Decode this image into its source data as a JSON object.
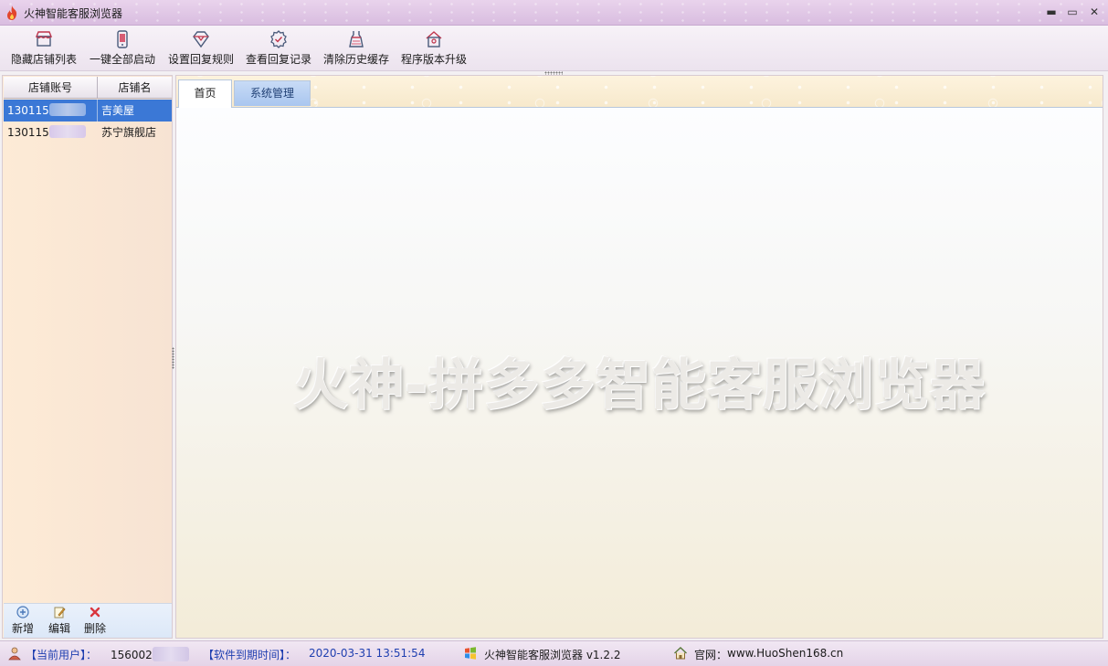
{
  "window": {
    "title": "火神智能客服浏览器",
    "minimize": "▬",
    "maximize": "▭",
    "close": "✕"
  },
  "toolbar": {
    "items": [
      {
        "label": "隐藏店铺列表",
        "icon": "store-icon"
      },
      {
        "label": "一键全部启动",
        "icon": "phone-icon"
      },
      {
        "label": "设置回复规则",
        "icon": "diamond-icon"
      },
      {
        "label": "查看回复记录",
        "icon": "badge-icon"
      },
      {
        "label": "清除历史缓存",
        "icon": "dress-icon"
      },
      {
        "label": "程序版本升级",
        "icon": "home-upgrade-icon"
      }
    ]
  },
  "shop_list": {
    "columns": [
      "店铺账号",
      "店铺名"
    ],
    "rows": [
      {
        "account": "130115",
        "name": "吉美屋",
        "selected": true
      },
      {
        "account": "130115",
        "name": "苏宁旗舰店",
        "selected": false
      }
    ],
    "footer": {
      "add": "新增",
      "edit": "编辑",
      "delete": "删除"
    }
  },
  "tabs": [
    {
      "label": "首页",
      "active": true
    },
    {
      "label": "系统管理",
      "active": false
    }
  ],
  "main": {
    "watermark": "火神-拼多多智能客服浏览器"
  },
  "status": {
    "user_label": "【当前用户】：",
    "user_value": "156002",
    "expire_label": "【软件到期时间】：",
    "expire_value": "2020-03-31 13:51:54",
    "app_version": "火神智能客服浏览器 v1.2.2",
    "website_label": "官网：",
    "website_value": "www.HuoShen168.cn"
  },
  "colors": {
    "selection": "#3b78d6",
    "status_blue": "#1f3fb0",
    "tab_inactive": "#a9c6ef"
  }
}
